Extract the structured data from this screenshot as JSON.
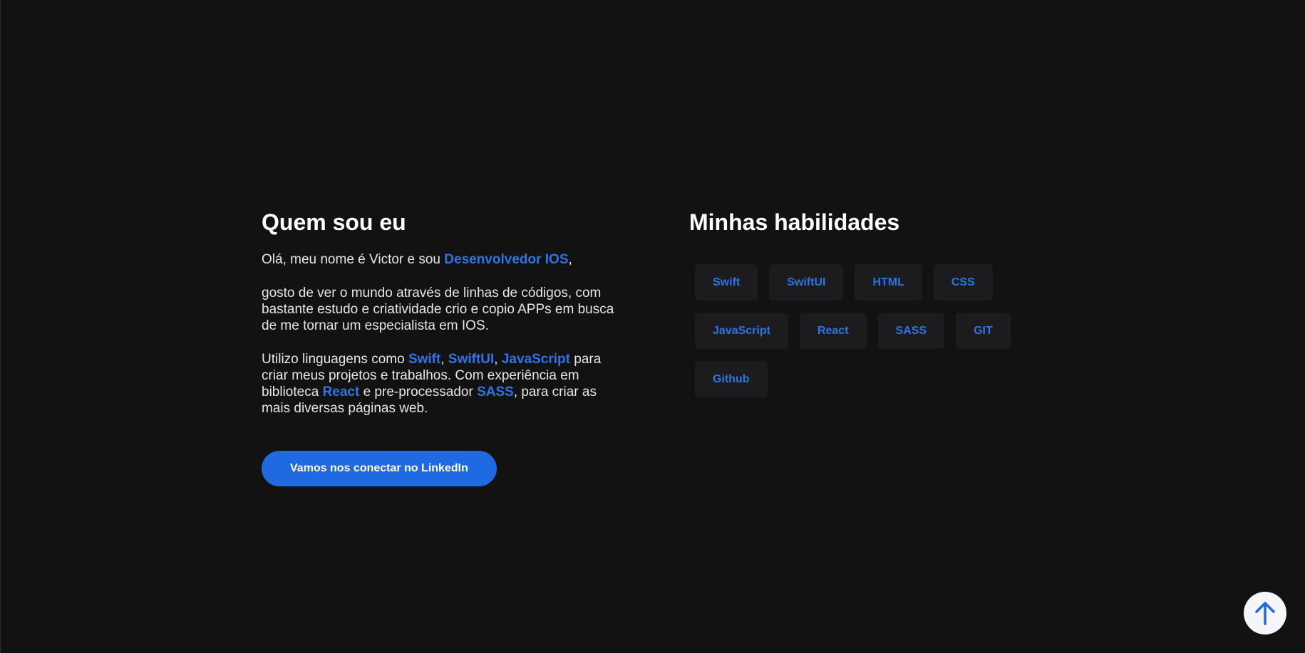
{
  "about": {
    "title": "Quem sou eu",
    "p1_pre": "Olá, meu nome é Victor e sou ",
    "p1_highlight": "Desenvolvedor IOS",
    "p1_post": ",",
    "p2": "gosto de ver o mundo através de linhas de códigos, com bastante estudo e criatividade crio e copio APPs em busca de me tornar um especialista em IOS.",
    "p3_t1": "Utilizo linguagens como ",
    "p3_h1": "Swift",
    "p3_t2": ", ",
    "p3_h2": "SwiftUI",
    "p3_t3": ", ",
    "p3_h3": "JavaScript",
    "p3_t4": " para criar meus projetos e trabalhos. Com experiência em biblioteca ",
    "p3_h4": "React",
    "p3_t5": " e pre-processador ",
    "p3_h5": "SASS",
    "p3_t6": ", para criar as mais diversas páginas web.",
    "cta_label": "Vamos nos conectar no LinkedIn"
  },
  "skills": {
    "title": "Minhas habilidades",
    "items": [
      "Swift",
      "SwiftUI",
      "HTML",
      "CSS",
      "JavaScript",
      "React",
      "SASS",
      "GIT",
      "Github"
    ]
  },
  "scroll_top": {
    "icon": "arrow-up-icon"
  },
  "colors": {
    "background": "#121212",
    "accent": "#2f74e4",
    "button": "#1f6ae0",
    "chip_bg": "#1c1c1e"
  }
}
